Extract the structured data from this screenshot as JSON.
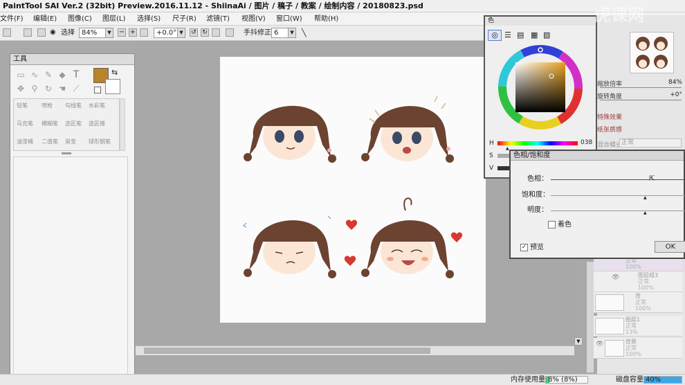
{
  "window": {
    "title": "PaintTool SAI Ver.2 (32bit) Preview.2016.11.12 - ShiinaAi / 图片 / 稿子 / 教案 / 绘制内容 / 20180823.psd"
  },
  "menu": [
    "文件(F)",
    "编辑(E)",
    "图像(C)",
    "图层(L)",
    "选择(S)",
    "尺子(R)",
    "滤镜(T)",
    "视图(V)",
    "窗口(W)",
    "帮助(H)"
  ],
  "toolbar": {
    "select_label": "选择",
    "zoom": "84%",
    "rotate": "+0.0°",
    "stabilizer_label": "手抖修正",
    "stabilizer": "6"
  },
  "tools_panel": {
    "title": "工具",
    "brushes": [
      "铅笔",
      "喷枪",
      "勾线笔",
      "水彩笔",
      "马克笔",
      "模糊笔",
      "选区笔",
      "选区擦",
      "油漆桶",
      "二值笔",
      "渐变",
      "球形钢笔"
    ]
  },
  "color_panel": {
    "title": "色",
    "h_label": "H",
    "h_value": "038",
    "s_label": "S",
    "v_label": "V",
    "primary_color": "#b8832a"
  },
  "navigator": {
    "zoom_label": "缩放倍率",
    "zoom_value": "84%",
    "angle_label": "旋转角度",
    "angle_value": "+0°"
  },
  "layer_props": {
    "effect": "特殊效果",
    "texture": "纸张质感",
    "blend_label": "混合模式",
    "blend_value": "正常"
  },
  "layers": [
    {
      "name": "",
      "mode": "正常",
      "opacity": "100%"
    },
    {
      "name": "图层组3",
      "mode": "正常",
      "opacity": "100%"
    },
    {
      "name": "背",
      "mode": "正常",
      "opacity": "100%"
    },
    {
      "name": "图层1",
      "mode": "正常",
      "opacity": "13%"
    },
    {
      "name": "背景",
      "mode": "正常",
      "opacity": "100%"
    }
  ],
  "dialog": {
    "title": "色相/饱和度",
    "hue_label": "色相：",
    "sat_label": "饱和度：",
    "light_label": "明度：",
    "colorize_label": "着色",
    "preview_label": "预览",
    "ok_label": "OK"
  },
  "status": {
    "memory_label": "内存使用量",
    "memory_value": "8% (8%)",
    "disk_label": "磁盘容量",
    "disk_value": "40%"
  },
  "watermark": "虎课网",
  "colors": {
    "accent_blue": "#3c3cd8",
    "hair_brown": "#6b4330",
    "bg_gray": "#a9a9a9"
  }
}
